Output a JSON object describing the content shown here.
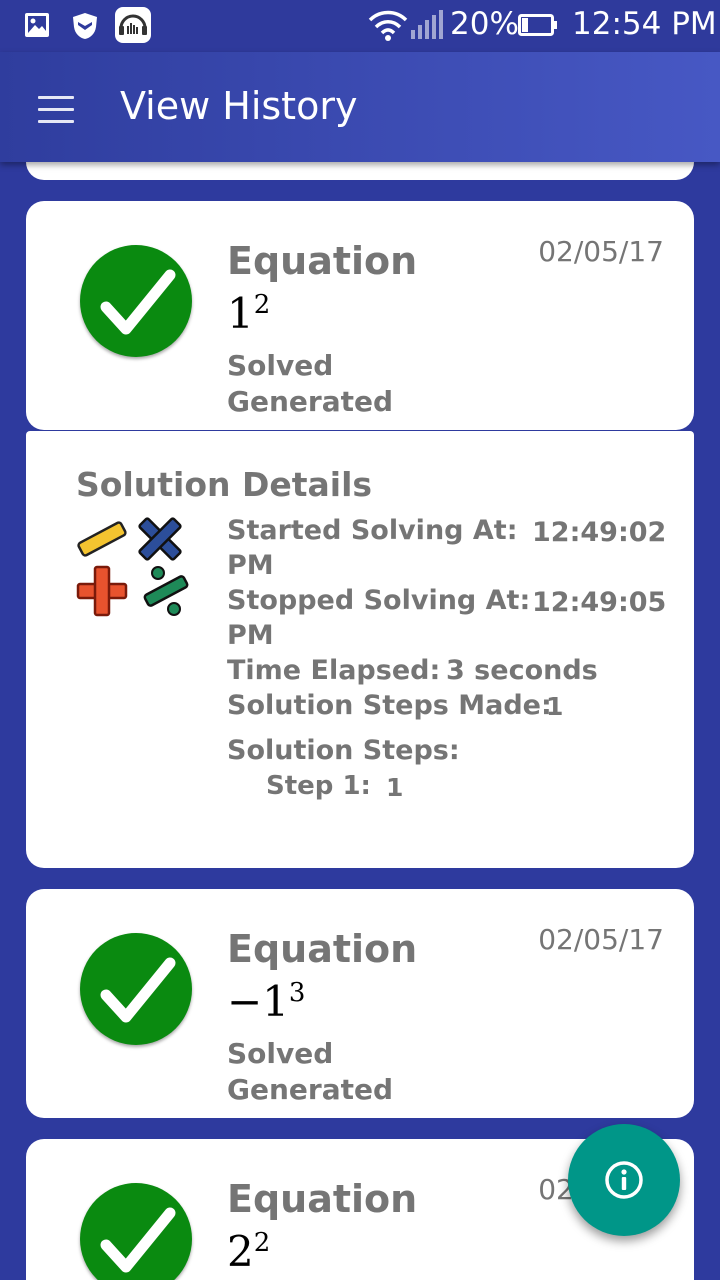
{
  "status_bar": {
    "icons": [
      "image-icon",
      "shield-icon",
      "music-app-icon",
      "wifi-icon",
      "signal-icon",
      "battery-icon"
    ],
    "battery": "20%",
    "time": "12:54 PM"
  },
  "app_bar": {
    "title": "View History",
    "menu_icon": "hamburger-menu-icon"
  },
  "history": [
    {
      "title": "Equation",
      "math_base": "1",
      "math_exp": "2",
      "date": "02/05/17",
      "status": "Solved",
      "source": "Generated",
      "icon": "check-icon"
    },
    {
      "title": "Equation",
      "math_base": "−1",
      "math_exp": "3",
      "date": "02/05/17",
      "status": "Solved",
      "source": "Generated",
      "icon": "check-icon"
    },
    {
      "title": "Equation",
      "math_base": "2",
      "math_exp": "2",
      "date": "02/05/17",
      "icon": "check-icon"
    }
  ],
  "solution_details": {
    "title": "Solution Details",
    "icon": "math-operators-icon",
    "started_label": "Started Solving At:",
    "started_value": "12:49:02",
    "started_suffix": "PM",
    "stopped_label": "Stopped Solving At:",
    "stopped_value": "12:49:05",
    "stopped_suffix": "PM",
    "elapsed_label": "Time Elapsed:",
    "elapsed_value": "3 seconds",
    "steps_made_label": "Solution Steps Made:",
    "steps_made_value": "1",
    "steps_label": "Solution Steps:",
    "steps": [
      {
        "label": "Step 1:",
        "value": "1"
      }
    ]
  },
  "fab": {
    "icon": "info-icon"
  },
  "colors": {
    "primary": "#3F51B5",
    "background": "#2E3A9E",
    "check_green": "#0A8A10",
    "fab_teal": "#009688",
    "text_grey": "#757575"
  }
}
